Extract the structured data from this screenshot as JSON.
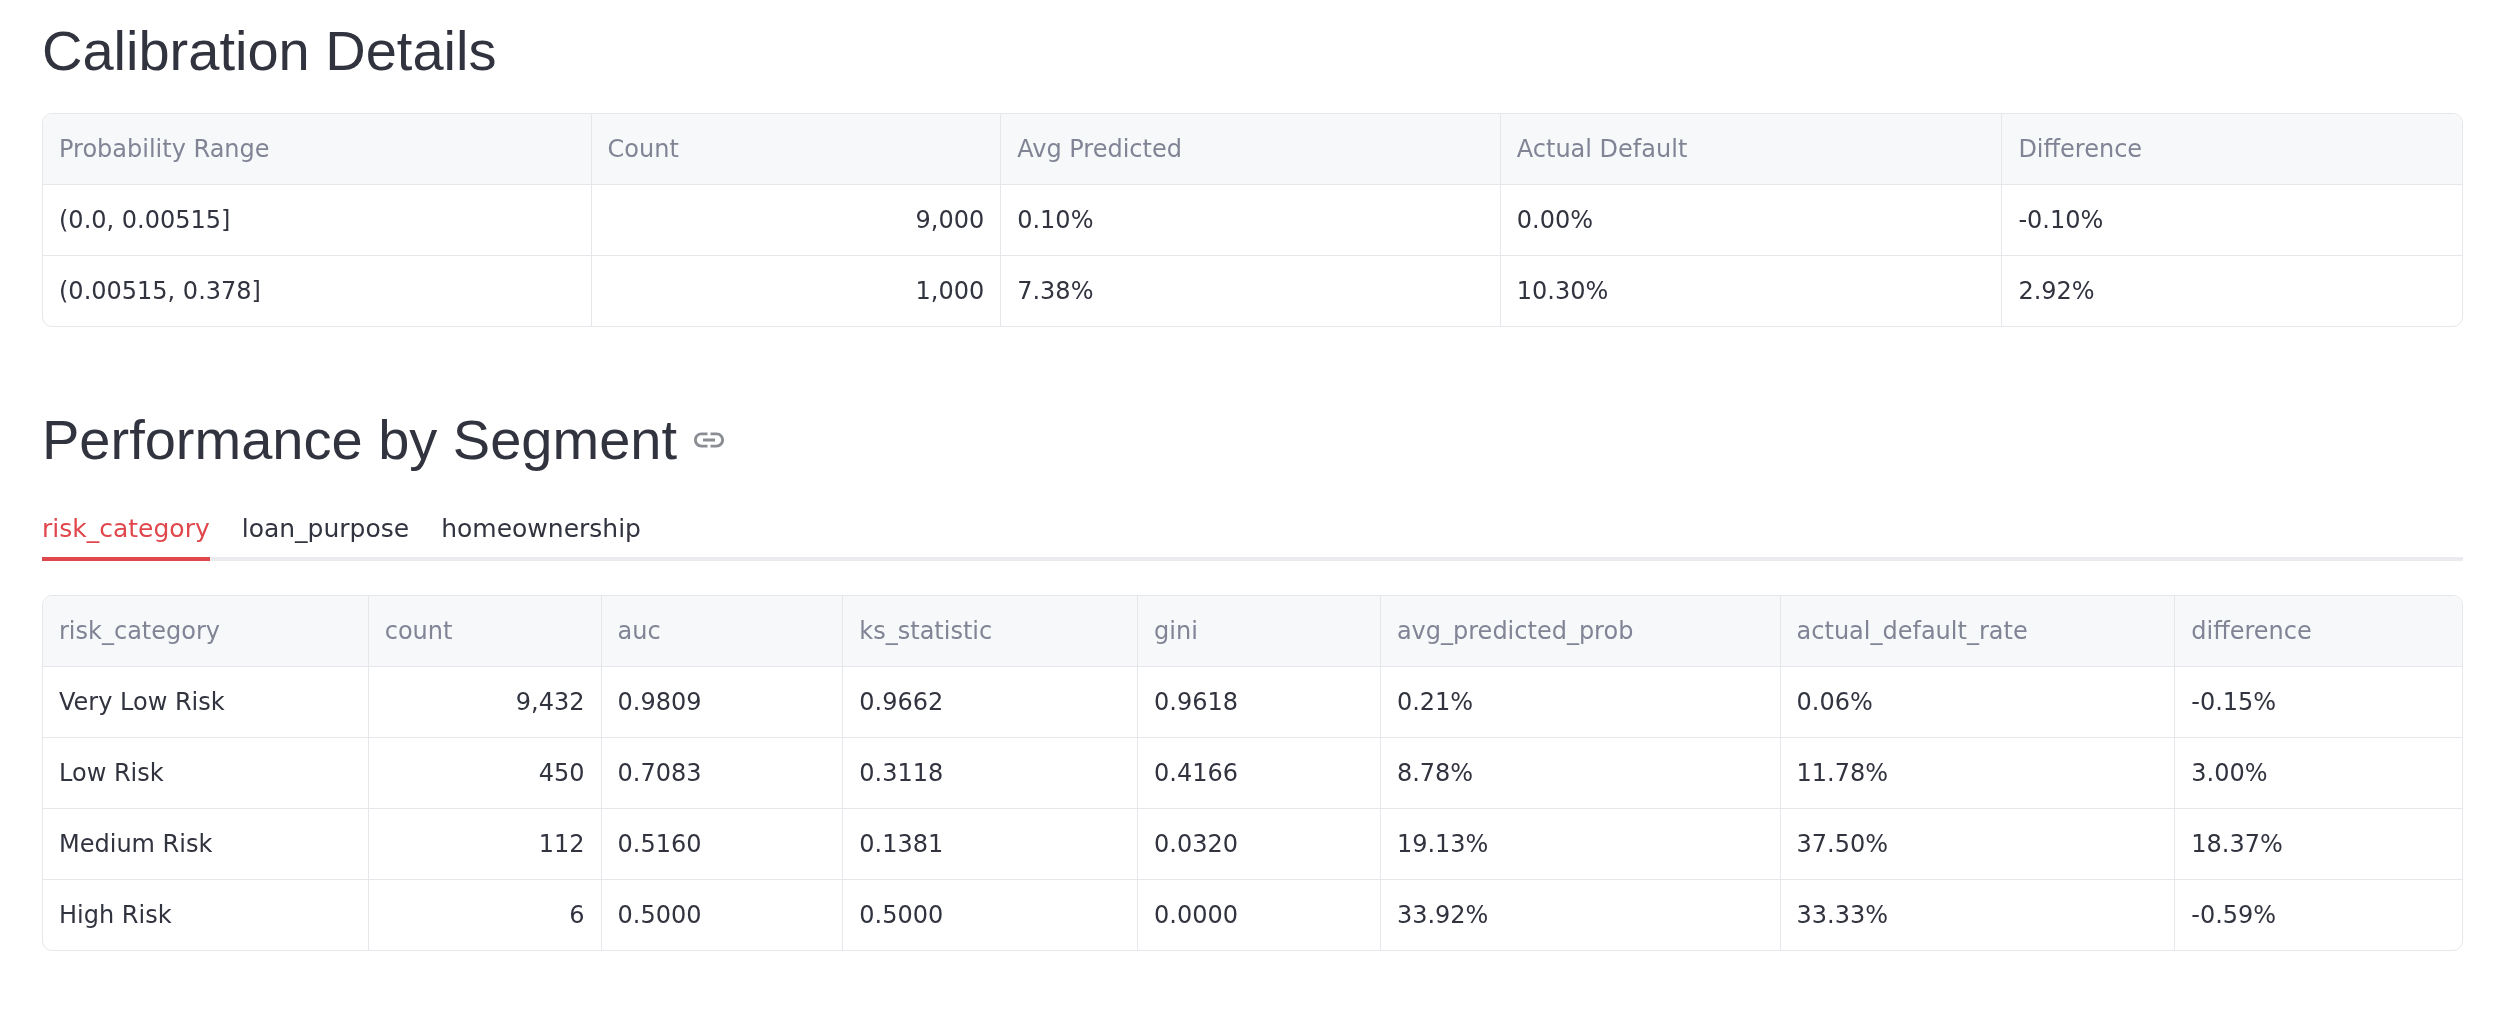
{
  "calibration": {
    "title": "Calibration Details",
    "columns": [
      {
        "label": "Probability Range",
        "numeric": false
      },
      {
        "label": "Count",
        "numeric": true
      },
      {
        "label": "Avg Predicted",
        "numeric": false
      },
      {
        "label": "Actual Default",
        "numeric": false
      },
      {
        "label": "Difference",
        "numeric": false
      }
    ],
    "rows": [
      [
        "(0.0, 0.00515]",
        "9,000",
        "0.10%",
        "0.00%",
        "-0.10%"
      ],
      [
        "(0.00515, 0.378]",
        "1,000",
        "7.38%",
        "10.30%",
        "2.92%"
      ]
    ]
  },
  "segment": {
    "title": "Performance by Segment",
    "tabs": [
      {
        "label": "risk_category",
        "selected": true
      },
      {
        "label": "loan_purpose",
        "selected": false
      },
      {
        "label": "homeownership",
        "selected": false
      }
    ],
    "columns": [
      {
        "label": "risk_category",
        "numeric": false
      },
      {
        "label": "count",
        "numeric": true
      },
      {
        "label": "auc",
        "numeric": false
      },
      {
        "label": "ks_statistic",
        "numeric": false
      },
      {
        "label": "gini",
        "numeric": false
      },
      {
        "label": "avg_predicted_prob",
        "numeric": false
      },
      {
        "label": "actual_default_rate",
        "numeric": false
      },
      {
        "label": "difference",
        "numeric": false
      }
    ],
    "rows": [
      [
        "Very Low Risk",
        "9,432",
        "0.9809",
        "0.9662",
        "0.9618",
        "0.21%",
        "0.06%",
        "-0.15%"
      ],
      [
        "Low Risk",
        "450",
        "0.7083",
        "0.3118",
        "0.4166",
        "8.78%",
        "11.78%",
        "3.00%"
      ],
      [
        "Medium Risk",
        "112",
        "0.5160",
        "0.1381",
        "0.0320",
        "19.13%",
        "37.50%",
        "18.37%"
      ],
      [
        "High Risk",
        "6",
        "0.5000",
        "0.5000",
        "0.0000",
        "33.92%",
        "33.33%",
        "-0.59%"
      ]
    ]
  }
}
